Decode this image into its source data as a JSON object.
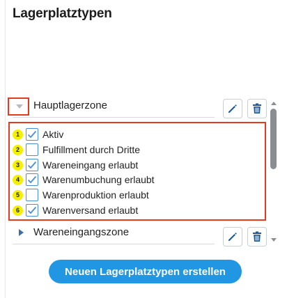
{
  "page": {
    "title": "Lagerplatztypen"
  },
  "zones": [
    {
      "label": "Hauptlagerzone",
      "expanded": true,
      "options": [
        {
          "badge": "1",
          "label": "Aktiv",
          "checked": true
        },
        {
          "badge": "2",
          "label": "Fulfillment durch Dritte",
          "checked": false
        },
        {
          "badge": "3",
          "label": "Wareneingang erlaubt",
          "checked": true
        },
        {
          "badge": "4",
          "label": "Warenumbuchung erlaubt",
          "checked": true
        },
        {
          "badge": "5",
          "label": "Warenproduktion erlaubt",
          "checked": false
        },
        {
          "badge": "6",
          "label": "Warenversand erlaubt",
          "checked": true
        }
      ]
    },
    {
      "label": "Wareneingangszone",
      "expanded": false
    }
  ],
  "actions": {
    "create_label": "Neuen Lagerplatztypen erstellen"
  },
  "icons": {
    "expand": "chevron-down-icon",
    "collapse": "chevron-right-icon",
    "edit": "pencil-icon",
    "delete": "trash-icon"
  },
  "colors": {
    "accent": "#2196e3",
    "highlight_frame": "#e23b1e",
    "badge": "#f5ef00",
    "checkbox": "#4a8fd6",
    "icon": "#1e5a96"
  }
}
